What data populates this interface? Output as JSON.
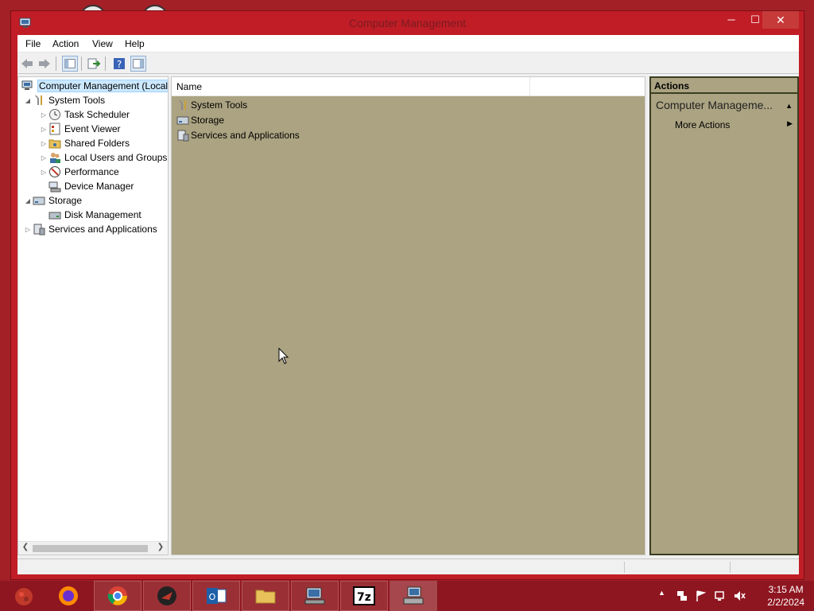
{
  "window": {
    "title": "Computer Management",
    "minimize": "─",
    "maximize": "☐",
    "close": "✕"
  },
  "menu": [
    "File",
    "Action",
    "View",
    "Help"
  ],
  "tree": {
    "items": [
      {
        "label": "Computer Management (Local",
        "icon": "computer-management-icon",
        "arrow": ""
      },
      {
        "label": "System Tools",
        "icon": "tools-icon",
        "arrow": "◢"
      },
      {
        "label": "Task Scheduler",
        "icon": "clock-icon",
        "arrow": "▷"
      },
      {
        "label": "Event Viewer",
        "icon": "event-viewer-icon",
        "arrow": "▷"
      },
      {
        "label": "Shared Folders",
        "icon": "shared-folder-icon",
        "arrow": "▷"
      },
      {
        "label": "Local Users and Groups",
        "icon": "users-icon",
        "arrow": "▷"
      },
      {
        "label": "Performance",
        "icon": "performance-icon",
        "arrow": "▷"
      },
      {
        "label": "Device Manager",
        "icon": "device-manager-icon",
        "arrow": ""
      },
      {
        "label": "Storage",
        "icon": "storage-icon",
        "arrow": "◢"
      },
      {
        "label": "Disk Management",
        "icon": "disk-icon",
        "arrow": ""
      },
      {
        "label": "Services and Applications",
        "icon": "services-icon",
        "arrow": "▷"
      }
    ]
  },
  "list": {
    "column_name": "Name",
    "rows": [
      "System Tools",
      "Storage",
      "Services and Applications"
    ]
  },
  "actions": {
    "header": "Actions",
    "group": "Computer Manageme...",
    "more": "More Actions"
  },
  "taskbar": {
    "time": "3:15 AM",
    "date": "2/2/2024"
  },
  "colors": {
    "window_frame": "#c01d26",
    "pane_bg": "#aba381",
    "selection": "#cce8ff"
  }
}
